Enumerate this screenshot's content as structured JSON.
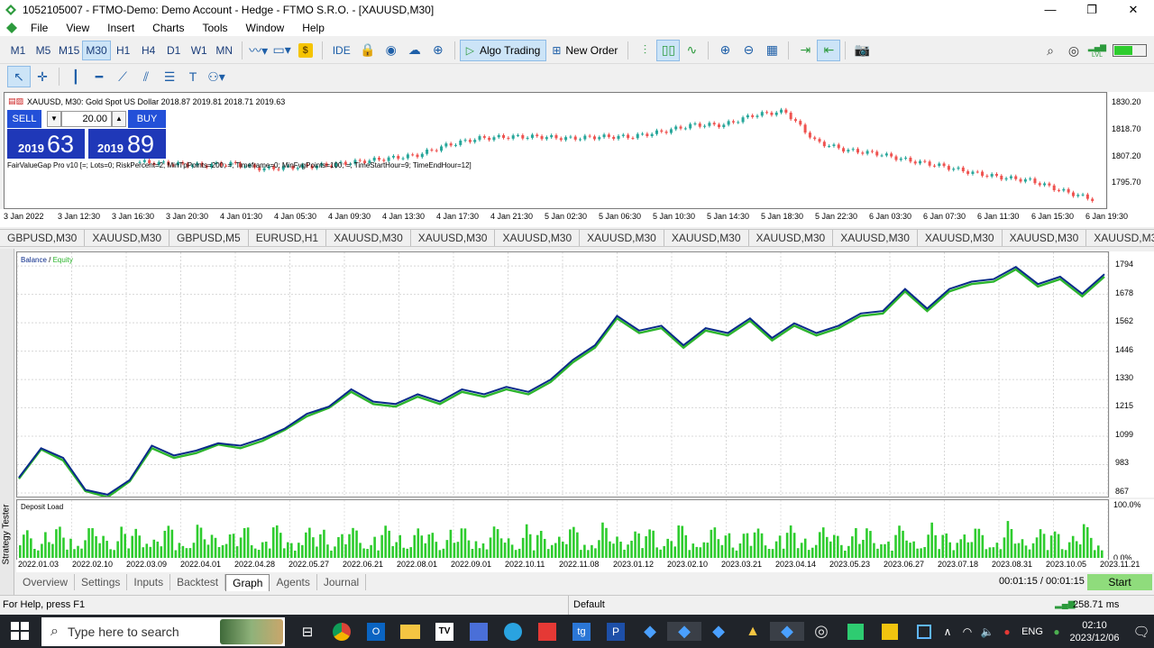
{
  "window": {
    "title": "1052105007 - FTMO-Demo: Demo Account - Hedge - FTMO S.R.O. - [XAUUSD,M30]",
    "controls": [
      "—",
      "❐",
      "✕"
    ]
  },
  "menu": [
    "File",
    "View",
    "Insert",
    "Charts",
    "Tools",
    "Window",
    "Help"
  ],
  "toolbar": {
    "timeframes": [
      "M1",
      "M5",
      "M15",
      "M30",
      "H1",
      "H4",
      "D1",
      "W1",
      "MN"
    ],
    "active_timeframe": "M30",
    "ide_label": "IDE",
    "algo_trading_label": "Algo Trading",
    "new_order_label": "New Order",
    "lvl_label": "LVL"
  },
  "chart": {
    "header": "XAUUSD, M30:  Gold Spot US Dollar  2018.87 2019.81 2018.71 2019.63",
    "sell_label": "SELL",
    "buy_label": "BUY",
    "lot": "20.00",
    "sell_big": "2019",
    "sell_digits": "63",
    "buy_big": "2019",
    "buy_digits": "89",
    "indicator": "FairValueGap Pro v10 [=; Lots=0; RiskPercent=2; MinTpPoints=200; =; Timeframe=0; MinFvgPoints=100; =; TimeStartHour=9; TimeEndHour=12]",
    "price_ticks": [
      "1830.20",
      "1818.70",
      "1807.20",
      "1795.70"
    ],
    "time_ticks": [
      "3 Jan 2022",
      "3 Jan 12:30",
      "3 Jan 16:30",
      "3 Jan 20:30",
      "4 Jan 01:30",
      "4 Jan 05:30",
      "4 Jan 09:30",
      "4 Jan 13:30",
      "4 Jan 17:30",
      "4 Jan 21:30",
      "5 Jan 02:30",
      "5 Jan 06:30",
      "5 Jan 10:30",
      "5 Jan 14:30",
      "5 Jan 18:30",
      "5 Jan 22:30",
      "6 Jan 03:30",
      "6 Jan 07:30",
      "6 Jan 11:30",
      "6 Jan 15:30",
      "6 Jan 19:30"
    ],
    "colors": {
      "bull": "#26a69a",
      "bear": "#ef5350"
    }
  },
  "symbol_tabs": [
    "GBPUSD,M30",
    "XAUUSD,M30",
    "GBPUSD,M5",
    "EURUSD,H1",
    "XAUUSD,M30",
    "XAUUSD,M30",
    "XAUUSD,M30",
    "XAUUSD,M30",
    "XAUUSD,M30",
    "XAUUSD,M30",
    "XAUUSD,M30",
    "XAUUSD,M30",
    "XAUUSD,M30",
    "XAUUSD,M30",
    "XA"
  ],
  "tester": {
    "side_label": "Strategy Tester",
    "legend_balance": "Balance",
    "legend_sep": " / ",
    "legend_equity": "Equity",
    "deposit_label": "Deposit Load",
    "deposit_ticks": [
      "100.0%",
      "0.0%"
    ],
    "tabs": [
      "Overview",
      "Settings",
      "Inputs",
      "Backtest",
      "Graph",
      "Agents",
      "Journal"
    ],
    "active_tab": "Graph",
    "timer": "00:01:15 / 00:01:15",
    "start_label": "Start",
    "colors": {
      "balance": "#0a2a8a",
      "equity": "#2db52d",
      "deposit": "#2ecc2e"
    }
  },
  "chart_data": {
    "type": "line",
    "title": "",
    "series": [
      {
        "name": "Balance",
        "values": [
          930,
          1050,
          1010,
          880,
          860,
          920,
          1060,
          1020,
          1040,
          1070,
          1060,
          1090,
          1130,
          1190,
          1220,
          1290,
          1240,
          1230,
          1270,
          1240,
          1290,
          1270,
          1300,
          1280,
          1330,
          1410,
          1470,
          1590,
          1530,
          1550,
          1470,
          1540,
          1520,
          1580,
          1500,
          1560,
          1520,
          1550,
          1600,
          1610,
          1700,
          1620,
          1700,
          1730,
          1740,
          1790,
          1720,
          1750,
          1680,
          1760
        ]
      },
      {
        "name": "Equity",
        "values": [
          925,
          1045,
          1000,
          875,
          850,
          915,
          1050,
          1010,
          1030,
          1065,
          1050,
          1080,
          1125,
          1180,
          1215,
          1280,
          1230,
          1220,
          1260,
          1230,
          1280,
          1260,
          1290,
          1270,
          1320,
          1400,
          1460,
          1580,
          1520,
          1540,
          1460,
          1530,
          1510,
          1570,
          1490,
          1550,
          1510,
          1540,
          1590,
          1600,
          1690,
          1610,
          1690,
          1720,
          1730,
          1780,
          1710,
          1740,
          1670,
          1750
        ]
      }
    ],
    "yticks": [
      "1794",
      "1678",
      "1562",
      "1446",
      "1330",
      "1215",
      "1099",
      "983",
      "867"
    ],
    "ylim": [
      867,
      1820
    ],
    "xticks": [
      "2022.01.03",
      "2022.02.10",
      "2022.03.09",
      "2022.04.01",
      "2022.04.28",
      "2022.05.27",
      "2022.06.21",
      "2022.08.01",
      "2022.09.01",
      "2022.10.11",
      "2022.11.08",
      "2023.01.12",
      "2023.02.10",
      "2023.03.21",
      "2023.04.14",
      "2023.05.23",
      "2023.06.27",
      "2023.07.18",
      "2023.08.31",
      "2023.10.05",
      "2023.11.21"
    ],
    "grid": true,
    "legend": "top-left"
  },
  "statusbar": {
    "help": "For Help, press F1",
    "profile": "Default",
    "ping": "258.71 ms"
  },
  "taskbar": {
    "search_placeholder": "Type here to search",
    "lang": "ENG",
    "time": "02:10",
    "date": "2023/12/06"
  }
}
